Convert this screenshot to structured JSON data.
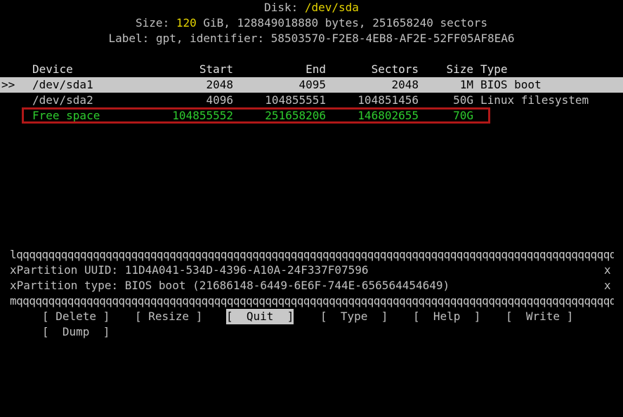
{
  "disk": {
    "title_prefix": "Disk: ",
    "device": "/dev/sda",
    "size_prefix": "Size: ",
    "size_value": "120",
    "size_rest": " GiB, 128849018880 bytes, 251658240 sectors",
    "label_line": "Label: gpt, identifier: 58503570-F2E8-4EB8-AF2E-52FF05AF8EA6"
  },
  "table": {
    "headers": {
      "device": "Device",
      "start": "Start",
      "end": "End",
      "sectors": "Sectors",
      "size": "Size",
      "type": "Type"
    },
    "rows": [
      {
        "marker": ">>",
        "device": "/dev/sda1",
        "start": "2048",
        "end": "4095",
        "sectors": "2048",
        "size": "1M",
        "type": "BIOS boot"
      },
      {
        "marker": "",
        "device": "/dev/sda2",
        "start": "4096",
        "end": "104855551",
        "sectors": "104851456",
        "size": "50G",
        "type": "Linux filesystem"
      },
      {
        "marker": "",
        "device": "Free space",
        "start": "104855552",
        "end": "251658206",
        "sectors": "146802655",
        "size": "70G",
        "type": ""
      }
    ]
  },
  "info": {
    "top_border": "lqqqqqqqqqqqqqqqqqqqqqqqqqqqqqqqqqqqqqqqqqqqqqqqqqqqqqqqqqqqqqqqqqqqqqqqqqqqqqqqqqqqqqqqqqqqqqqqqqqqqqqqqqqqqqqqqqqqqqqqqk",
    "uuid_line": "xPartition UUID: 11D4A041-534D-4396-A10A-24F337F07596",
    "type_line": "xPartition type: BIOS boot (21686148-6449-6E6F-744E-656564454649)",
    "right_edge": "x",
    "bottom_border": "mqqqqqqqqqqqqqqqqqqqqqqqqqqqqqqqqqqqqqqqqqqqqqqqqqqqqqqqqqqqqqqqqqqqqqqqqqqqqqqqqqqqqqqqqqqqqqqqqqqqqqqqqqqqqqqqqqqqqqqqqqj"
  },
  "menu": {
    "delete": "[ Delete ]",
    "resize": "[ Resize ]",
    "quit": "[  Quit  ]",
    "type": "[  Type  ]",
    "help": "[  Help  ]",
    "write": "[  Write ]",
    "dump": "[  Dump  ]"
  },
  "colors": {
    "highlight_box": "#b01818",
    "free_space": "#2ecc2e",
    "device_title": "#e5d400",
    "selected_bg": "#c8c8c8"
  }
}
